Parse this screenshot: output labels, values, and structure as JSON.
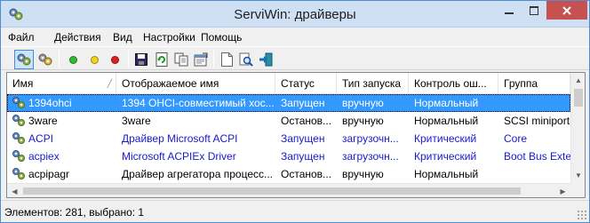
{
  "window": {
    "title": "ServiWin: драйверы"
  },
  "menu": [
    {
      "id": "file",
      "label": "Файл"
    },
    {
      "id": "actions",
      "label": "Действия"
    },
    {
      "id": "view",
      "label": "Вид"
    },
    {
      "id": "settings",
      "label": "Настройки"
    },
    {
      "id": "help",
      "label": "Помощь"
    }
  ],
  "toolbar": {
    "buttons": [
      {
        "id": "drivers",
        "icon": "gears-icon",
        "active": true
      },
      {
        "id": "services",
        "icon": "gears-alt-icon",
        "active": false
      },
      {
        "id": "start",
        "icon": "green-dot-icon",
        "color": "#2ebd2e"
      },
      {
        "id": "pause",
        "icon": "yellow-dot-icon",
        "color": "#f2d21b"
      },
      {
        "id": "stop",
        "icon": "red-dot-icon",
        "color": "#e02020"
      },
      {
        "id": "save",
        "icon": "floppy-icon"
      },
      {
        "id": "refresh",
        "icon": "refresh-icon"
      },
      {
        "id": "copy",
        "icon": "copy-icon"
      },
      {
        "id": "properties",
        "icon": "properties-icon"
      },
      {
        "id": "html-report",
        "icon": "document-icon"
      },
      {
        "id": "find",
        "icon": "find-icon"
      },
      {
        "id": "exit",
        "icon": "exit-icon"
      }
    ]
  },
  "list": {
    "columns": [
      "Имя",
      "Отображаемое имя",
      "Статус",
      "Тип запуска",
      "Контроль ош...",
      "Группа"
    ],
    "rows": [
      {
        "name": "1394ohci",
        "display": "1394 OHCI-совместимый хос...",
        "status": "Запущен",
        "start": "вручную",
        "control": "Нормальный",
        "group": "",
        "selected": true,
        "blue": false
      },
      {
        "name": "3ware",
        "display": "3ware",
        "status": "Останов...",
        "start": "вручную",
        "control": "Нормальный",
        "group": "SCSI miniport",
        "selected": false,
        "blue": false
      },
      {
        "name": "ACPI",
        "display": "Драйвер Microsoft ACPI",
        "status": "Запущен",
        "start": "загрузочн...",
        "control": "Критический",
        "group": "Core",
        "selected": false,
        "blue": true
      },
      {
        "name": "acpiex",
        "display": "Microsoft ACPIEx Driver",
        "status": "Запущен",
        "start": "загрузочн...",
        "control": "Критический",
        "group": "Boot Bus Exten",
        "selected": false,
        "blue": true
      },
      {
        "name": "acpipagr",
        "display": "Драйвер агрегатора процесс...",
        "status": "Останов...",
        "start": "вручную",
        "control": "Нормальный",
        "group": "",
        "selected": false,
        "blue": false
      }
    ]
  },
  "status": {
    "text": "Элементов: 281, выбрано: 1"
  },
  "colors": {
    "selection": "#3399ff",
    "running_text": "#1a1acc",
    "close_button": "#c75050"
  }
}
